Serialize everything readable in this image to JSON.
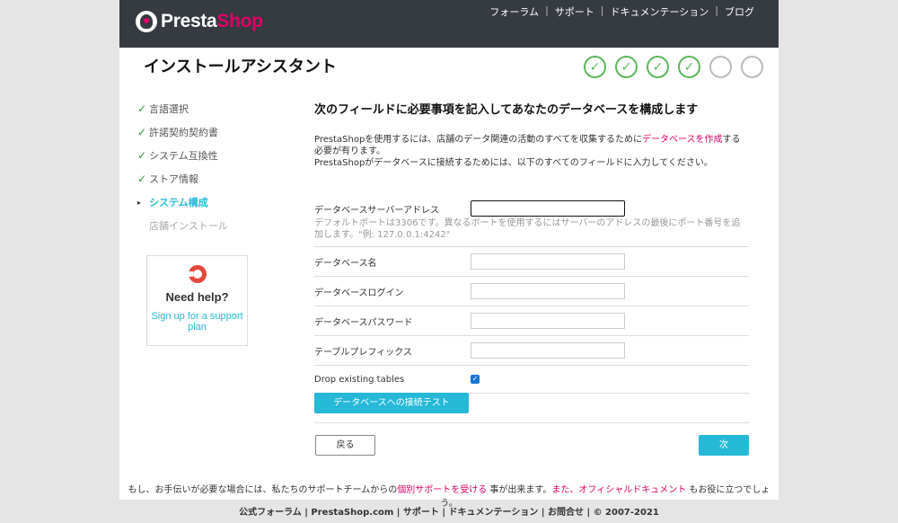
{
  "header": {
    "logo_part1": "Presta",
    "logo_part2": "Shop",
    "nav": [
      "フォーラム",
      "サポート",
      "ドキュメンテーション",
      "ブログ"
    ]
  },
  "page_title": "インストールアシスタント",
  "steps": [
    "✓",
    "✓",
    "✓",
    "✓",
    "",
    ""
  ],
  "sidebar": {
    "items": [
      {
        "mark": "✓",
        "label": "言語選択"
      },
      {
        "mark": "✓",
        "label": "許諾契約契約書"
      },
      {
        "mark": "✓",
        "label": "システム互換性"
      },
      {
        "mark": "✓",
        "label": "ストア情報"
      },
      {
        "mark": "▸",
        "label": "システム構成"
      },
      {
        "mark": "",
        "label": "店舗インストール"
      }
    ]
  },
  "help": {
    "title": "Need help?",
    "link": "Sign up for a support plan"
  },
  "main": {
    "heading": "次のフィールドに必要事項を記入してあなたのデータベースを構成します",
    "intro_1a": "PrestaShopを使用するには、店舗のデータ関連の活動のすべてを収集するために",
    "intro_link": "データベースを作成",
    "intro_1b": "する必要が有ります。",
    "intro_2": "PrestaShopがデータベースに接続するためには、以下のすべてのフィールドに入力してください。"
  },
  "form": {
    "server_label": "データベースサーバーアドレス",
    "server_value": "",
    "server_hint": "デフォルトポートは3306です。異なるポートを使用するにはサーバーのアドレスの最後にポート番号を追加します。\"例: 127.0.0.1:4242\"",
    "dbname_label": "データベース名",
    "dbname_value": "",
    "login_label": "データベースログイン",
    "login_value": "",
    "password_label": "データベースパスワード",
    "password_value": "",
    "prefix_label": "テーブルプレフィックス",
    "prefix_value": "",
    "drop_label": "Drop existing tables",
    "drop_checked": "✓",
    "test_button": "データベースへの接続テスト"
  },
  "buttons": {
    "back": "戻る",
    "next": "次"
  },
  "support": {
    "text_a": "もし、お手伝いが必要な場合には、私たちのサポートチームからの",
    "link_a": "個別サポートを受ける",
    "text_b": " 事が出来ます。",
    "link_b": "また、オフィシャルドキュメント",
    "text_c": " もお役に立つでしょう。"
  },
  "footer": "公式フォーラム | PrestaShop.com | サポート | ドキュメンテーション | お問合せ | © 2007-2021"
}
